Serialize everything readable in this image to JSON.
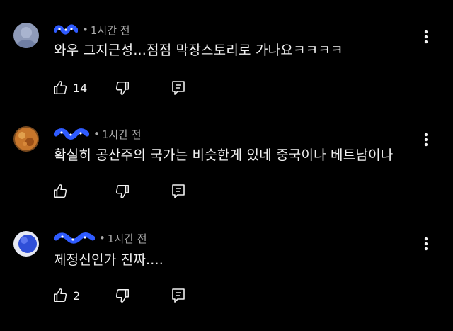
{
  "colors": {
    "background": "#000000",
    "text": "#f1f1f1",
    "meta": "#aaaaaa",
    "icon": "#f1f1f1",
    "username_scribble": "#2f5bff"
  },
  "comments": [
    {
      "username": "",
      "separator": "•",
      "time": "1시간 전",
      "text": "와우 그지근성...점점 막장스토리로 가나요ㅋㅋㅋㅋ",
      "like_count": "14",
      "avatar": "gray-blue-avatar",
      "icons": [
        "thumb-up-icon",
        "thumb-down-icon",
        "reply-icon",
        "more-vert-icon"
      ]
    },
    {
      "username": "",
      "separator": "•",
      "time": "1시간 전",
      "text": "확실히 공산주의 국가는 비슷한게 있네 중국이나 베트남이나",
      "like_count": "",
      "avatar": "orange-photo-avatar",
      "icons": [
        "thumb-up-icon",
        "thumb-down-icon",
        "reply-icon",
        "more-vert-icon"
      ]
    },
    {
      "username": "",
      "separator": "•",
      "time": "1시간 전",
      "text": "제정신인가 진짜....",
      "like_count": "2",
      "avatar": "blue-white-avatar",
      "icons": [
        "thumb-up-icon",
        "thumb-down-icon",
        "reply-icon",
        "more-vert-icon"
      ]
    }
  ]
}
